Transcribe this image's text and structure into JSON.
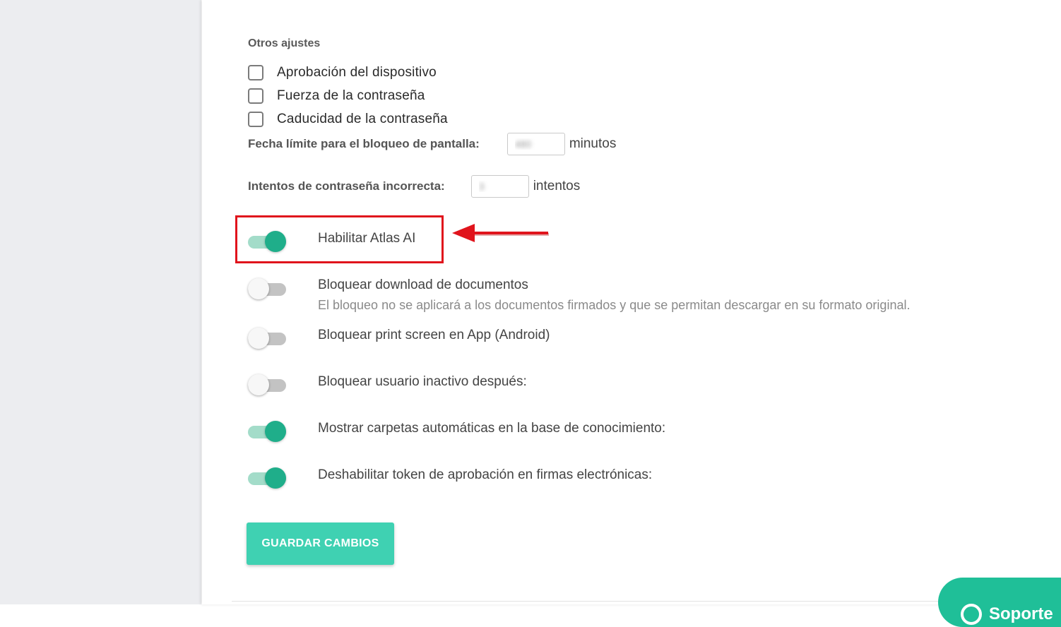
{
  "other_settings": {
    "title": "Otros ajustes",
    "checkboxes": [
      {
        "label": "Aprobación del dispositivo",
        "checked": false
      },
      {
        "label": "Fuerza de la contraseña",
        "checked": false
      },
      {
        "label": "Caducidad de la contraseña",
        "checked": false
      }
    ]
  },
  "screen_lock": {
    "label": "Fecha límite para el bloqueo de pantalla:",
    "value": "480",
    "unit": "minutos"
  },
  "password_attempts": {
    "label": "Intentos de contraseña incorrecta:",
    "value": "3",
    "unit": "intentos"
  },
  "toggles": [
    {
      "label": "Habilitar Atlas AI",
      "enabled": true
    },
    {
      "label": "Bloquear download de documentos",
      "enabled": false,
      "description": "El bloqueo no se aplicará a los documentos firmados y que se permitan descargar en su formato original."
    },
    {
      "label": "Bloquear print screen en App (Android)",
      "enabled": false
    },
    {
      "label": "Bloquear usuario inactivo después:",
      "enabled": false
    },
    {
      "label": "Mostrar carpetas automáticas en la base de conocimiento:",
      "enabled": true
    },
    {
      "label": "Deshabilitar token de aprobación en firmas electrónicas:",
      "enabled": true
    }
  ],
  "save_button": {
    "label": "GUARDAR CAMBIOS"
  },
  "support_button": {
    "label": "Soporte",
    "icon": "search-icon"
  },
  "colors": {
    "accent": "#1fae8a",
    "button": "#3fd1b2",
    "highlight": "#e0141c"
  }
}
